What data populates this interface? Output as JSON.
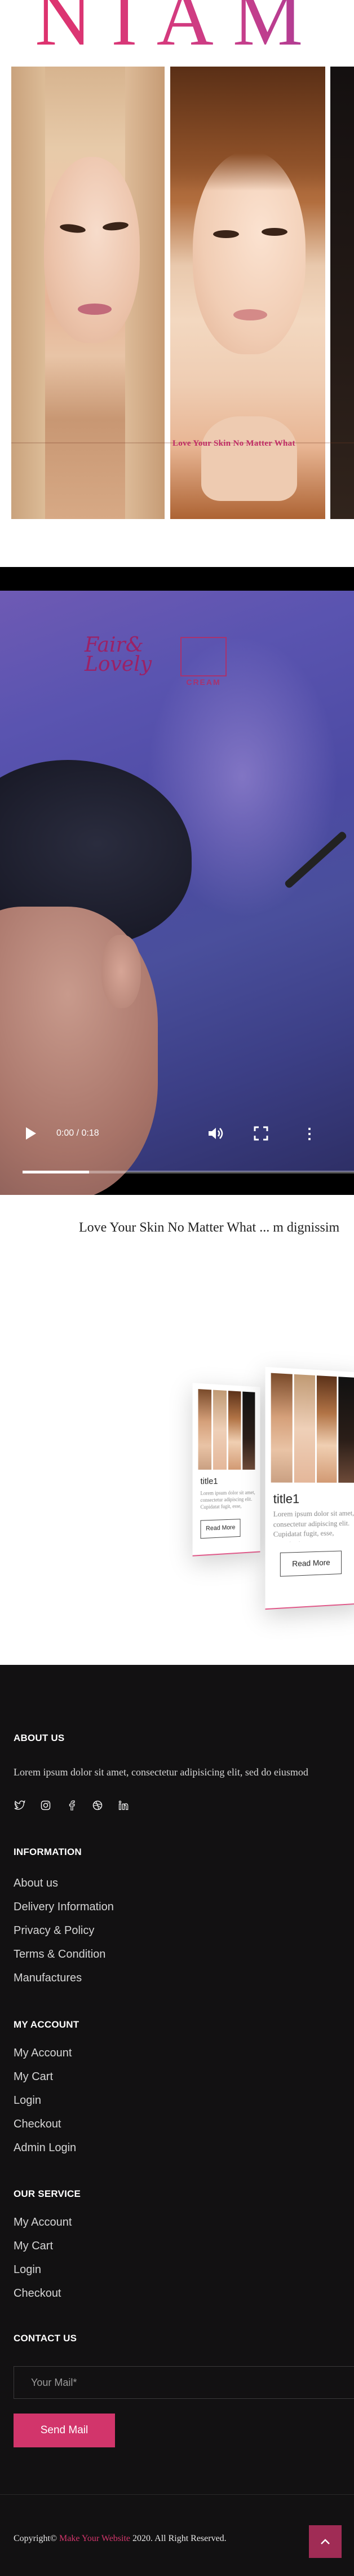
{
  "hero": {
    "title": "NIAM",
    "caption": "Love Your Skin No Matter What"
  },
  "video": {
    "brand_script_line1": "Fair",
    "brand_script_amp": "&",
    "brand_script_line2": "Lovely",
    "brand_box_text": "CREAM",
    "time": "0:00 / 0:18",
    "progress": 0.0,
    "buffered_fraction": 0.2
  },
  "marquee": {
    "text": "Love Your Skin No Matter What ... m dignissim"
  },
  "cards": [
    {
      "title": "title1",
      "text": "Lorem ipsum dolor sit amet, consectetur adipiscing elit. Cupidatat fugit, esse, exercitation",
      "button": "Read More"
    },
    {
      "title": "title1",
      "text": "Lorem ipsum dolor sit amet, consectetur adipiscing elit. Cupidatat fugit, esse, exercitation",
      "button": "Read More"
    }
  ],
  "footer": {
    "about": {
      "heading": "ABOUT US",
      "text": "Lorem ipsum dolor sit amet, consectetur adipisicing elit, sed do eiusmod"
    },
    "social_icons": [
      "twitter-icon",
      "instagram-icon",
      "facebook-icon",
      "dribbble-icon",
      "linkedin-icon"
    ],
    "information": {
      "heading": "INFORMATION",
      "links": [
        "About us",
        "Delivery Information",
        "Privacy & Policy",
        "Terms & Condition",
        "Manufactures"
      ]
    },
    "my_account": {
      "heading": "MY ACCOUNT",
      "links": [
        "My Account",
        "My Cart",
        "Login",
        "Checkout",
        "Admin Login"
      ]
    },
    "our_service": {
      "heading": "OUR SERVICE",
      "links": [
        "My Account",
        "My Cart",
        "Login",
        "Checkout"
      ]
    },
    "contact": {
      "heading": "CONTACT US",
      "email_placeholder": "Your Mail*",
      "send_label": "Send Mail"
    },
    "copyright": {
      "prefix": "Copyright©",
      "site": "Make Your Website",
      "suffix": "2020. All Right Reserved."
    },
    "back_to_top_icon": "chevron-up-icon"
  },
  "colors": {
    "accent": "#d2356b",
    "footer_bg": "#121112",
    "brand": "#9b2166"
  }
}
